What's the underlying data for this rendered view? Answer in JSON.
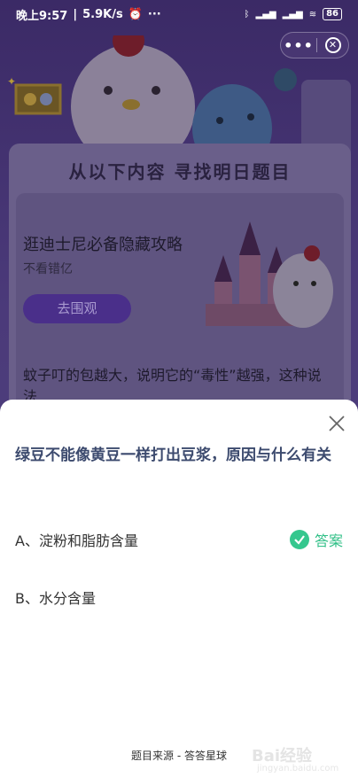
{
  "status_bar": {
    "time": "晚上9:57",
    "speed": "5.9K/s",
    "more": "···",
    "battery": "86"
  },
  "capsule": {
    "more_label": "•••"
  },
  "background": {
    "card_title": "从以下内容 寻找明日题目",
    "ad_title": "逛迪士尼必备隐藏攻略",
    "ad_subtitle": "不看错亿",
    "ad_button": "去围观",
    "previous_question": "蚊子叮的包越大，说明它的“毒性”越强，这种说法"
  },
  "sheet": {
    "question": "绿豆不能像黄豆一样打出豆浆，原因与什么有关",
    "options": [
      {
        "label": "A、淀粉和脂肪含量",
        "is_answer": true
      },
      {
        "label": "B、水分含量",
        "is_answer": false
      }
    ],
    "answer_label": "答案",
    "source": "题目来源 - 答答星球"
  },
  "watermark": {
    "text": "Bai经验",
    "url": "jingyan.baidu.com"
  },
  "colors": {
    "accent_green": "#35c78e",
    "question_text": "#3c4a6e",
    "overlay_purple": "#4b3a7a"
  }
}
